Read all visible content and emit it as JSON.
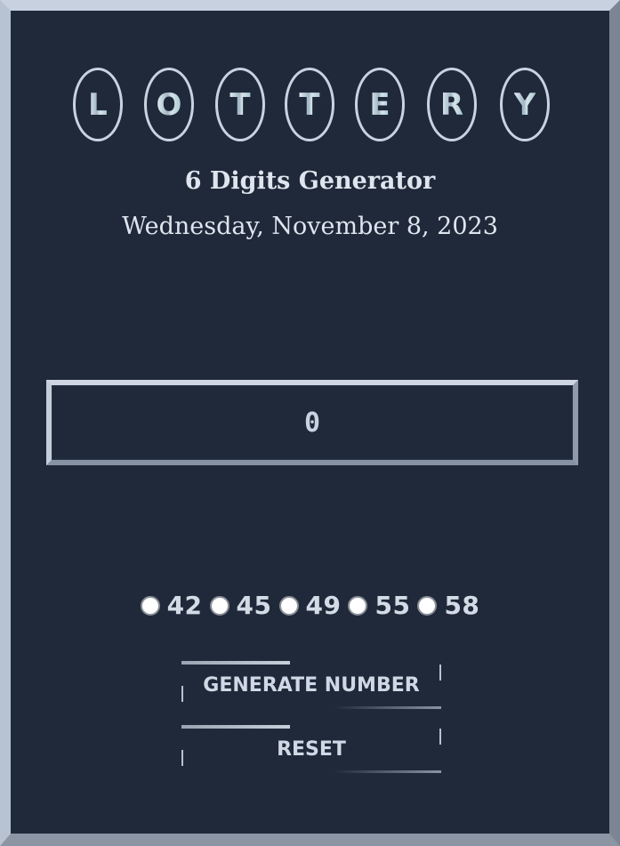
{
  "logo": {
    "letters": [
      "L",
      "O",
      "T",
      "T",
      "E",
      "R",
      "Y"
    ]
  },
  "subtitle": "6 Digits Generator",
  "date": "Wednesday, November 8, 2023",
  "display": {
    "value": "0"
  },
  "options": [
    {
      "label": "42",
      "selected": false
    },
    {
      "label": "45",
      "selected": false
    },
    {
      "label": "49",
      "selected": false
    },
    {
      "label": "55",
      "selected": false
    },
    {
      "label": "58",
      "selected": false
    }
  ],
  "buttons": {
    "generate": "GENERATE NUMBER",
    "reset": "RESET"
  },
  "colors": {
    "background": "#1f293a",
    "frame": "#b8c3d2",
    "text": "#dfe5ee",
    "letter_gradient": "#a9c9cf"
  }
}
